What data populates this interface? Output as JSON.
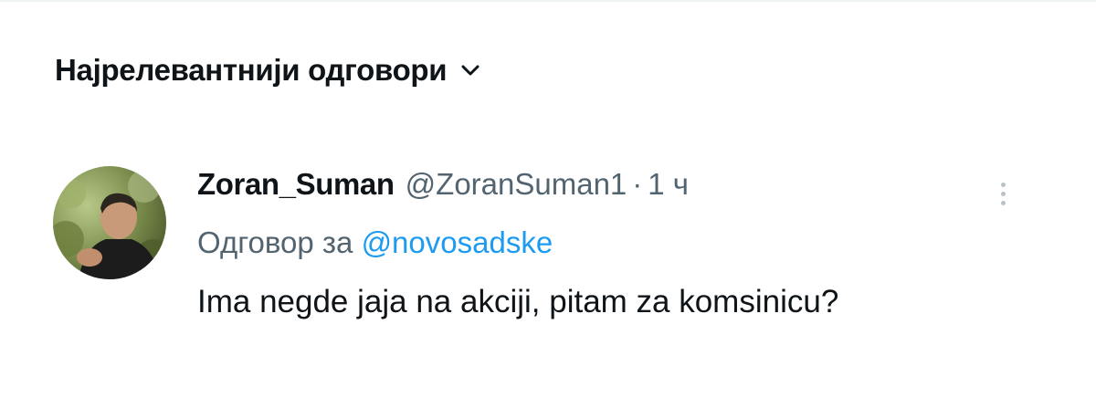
{
  "sort": {
    "label": "Најрелевантнији одговори",
    "icon": "chevron-down-icon"
  },
  "reply": {
    "display_name": "Zoran_Suman",
    "handle": "@ZoranSuman1",
    "separator": "·",
    "time": "1 ч",
    "replying_to_prefix": "Одговор за",
    "replying_to_handle": "@novosadske",
    "text": "Ima negde jaja na akciji, pitam za komsinicu?",
    "avatar": "user-avatar-photo",
    "more_icon": "more-vertical-icon"
  },
  "colors": {
    "primary_text": "#0f1419",
    "secondary_text": "#536471",
    "link": "#1d9bf0"
  }
}
